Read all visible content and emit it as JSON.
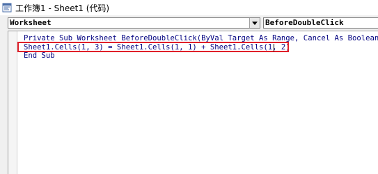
{
  "window": {
    "title": "工作簿1 - Sheet1 (代码)",
    "icon": "vba-module-icon"
  },
  "toolbar": {
    "object_combo_value": "Worksheet",
    "procedure_combo_value": "BeforeDoubleClick"
  },
  "code": {
    "lines": [
      "Private Sub Worksheet_BeforeDoubleClick(ByVal Target As Range, Cancel As Boolean)",
      "Sheet1.Cells(1, 3) = Sheet1.Cells(1, 1) + Sheet1.Cells(1, 2)",
      "End Sub"
    ]
  },
  "colors": {
    "highlight": "#e0202a",
    "code_text": "#000080"
  }
}
